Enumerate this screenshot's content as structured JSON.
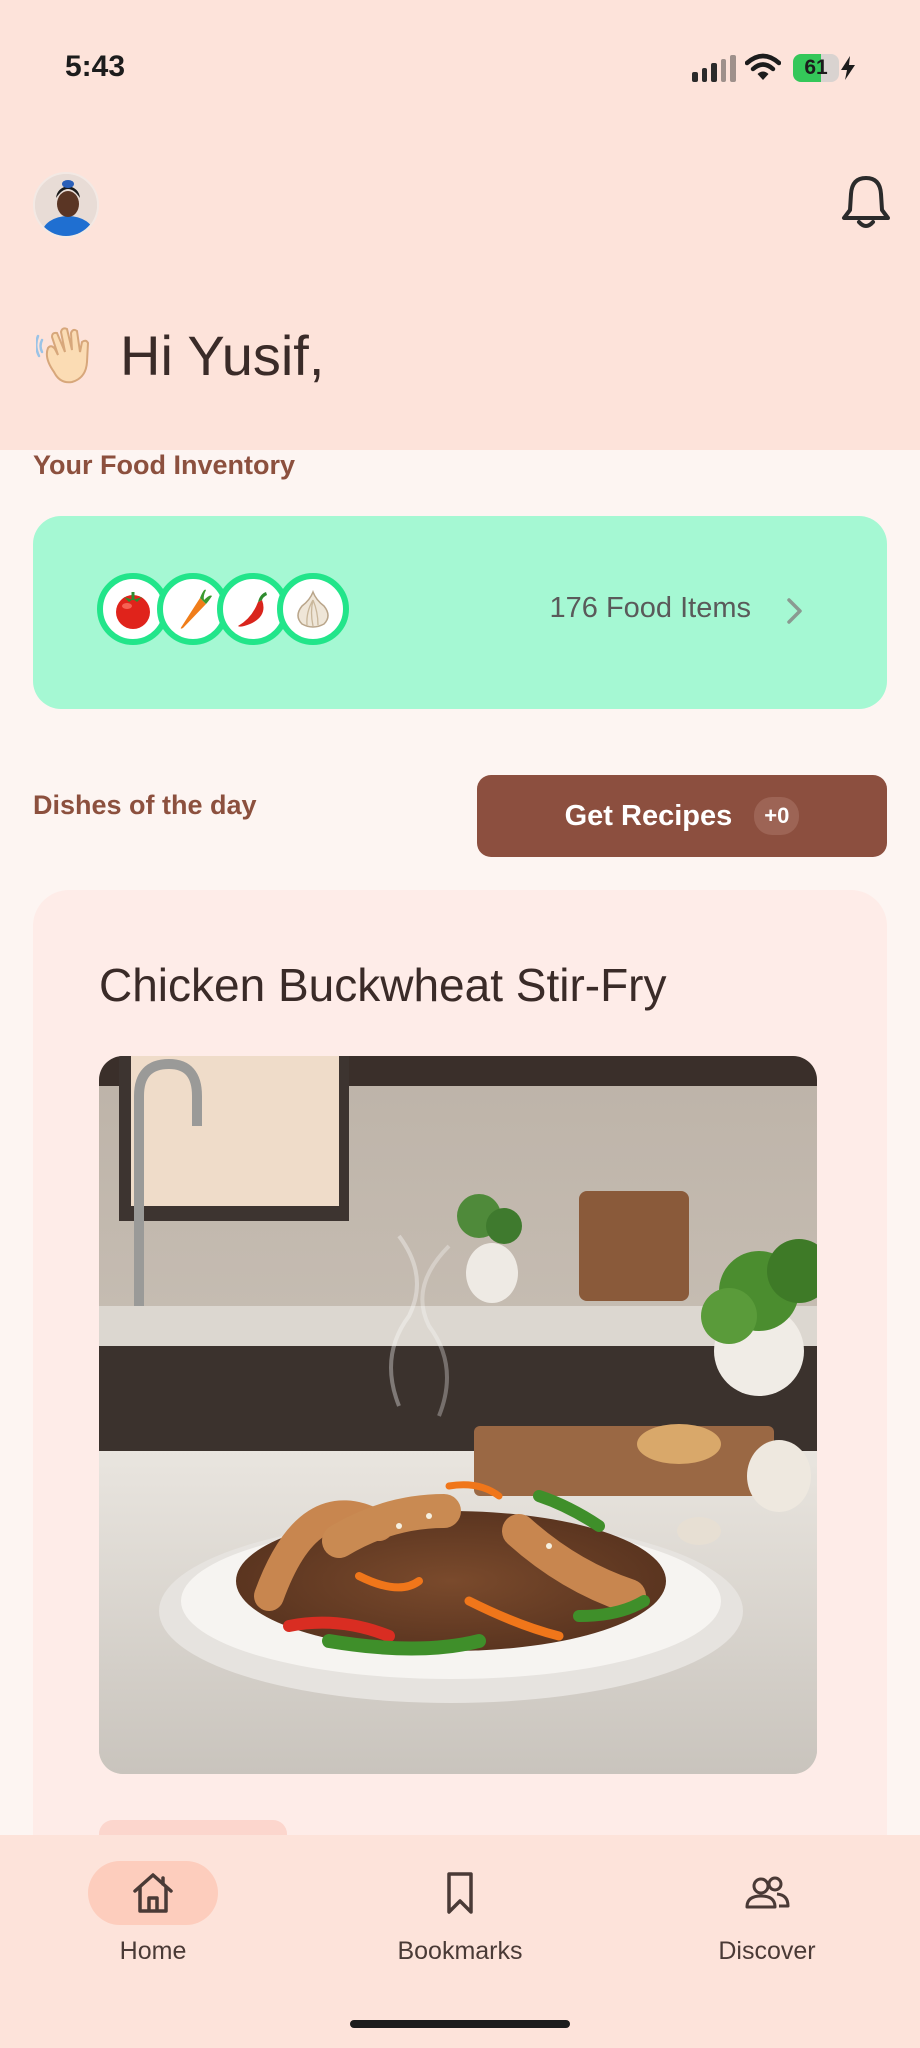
{
  "status_bar": {
    "time": "5:43",
    "battery_percent": "61",
    "battery_level": 0.61,
    "charging": true
  },
  "header": {
    "avatar_icon": "user-avatar",
    "notification_icon": "bell-icon",
    "greeting_emoji": "waving-hand",
    "greeting": "Hi Yusif,"
  },
  "inventory": {
    "label": "Your Food Inventory",
    "items": [
      "tomato",
      "carrot",
      "chili-pepper",
      "garlic"
    ],
    "count_text": "176 Food Items"
  },
  "dishes": {
    "label": "Dishes of the day",
    "get_recipes_label": "Get Recipes",
    "get_recipes_count": "+0",
    "card": {
      "title": "Chicken Buckwheat Stir-Fry",
      "image": "chicken buckwheat stir-fry plate on kitchen counter"
    }
  },
  "bottom_nav": {
    "items": [
      {
        "label": "Home",
        "icon": "home-icon",
        "active": true
      },
      {
        "label": "Bookmarks",
        "icon": "bookmark-icon",
        "active": false
      },
      {
        "label": "Discover",
        "icon": "people-icon",
        "active": false
      }
    ]
  },
  "colors": {
    "header_bg": "#fde3da",
    "inventory_bg": "#a5f8d3",
    "accent_brown": "#8c4f3f",
    "bubble_ring": "#22e58a"
  }
}
